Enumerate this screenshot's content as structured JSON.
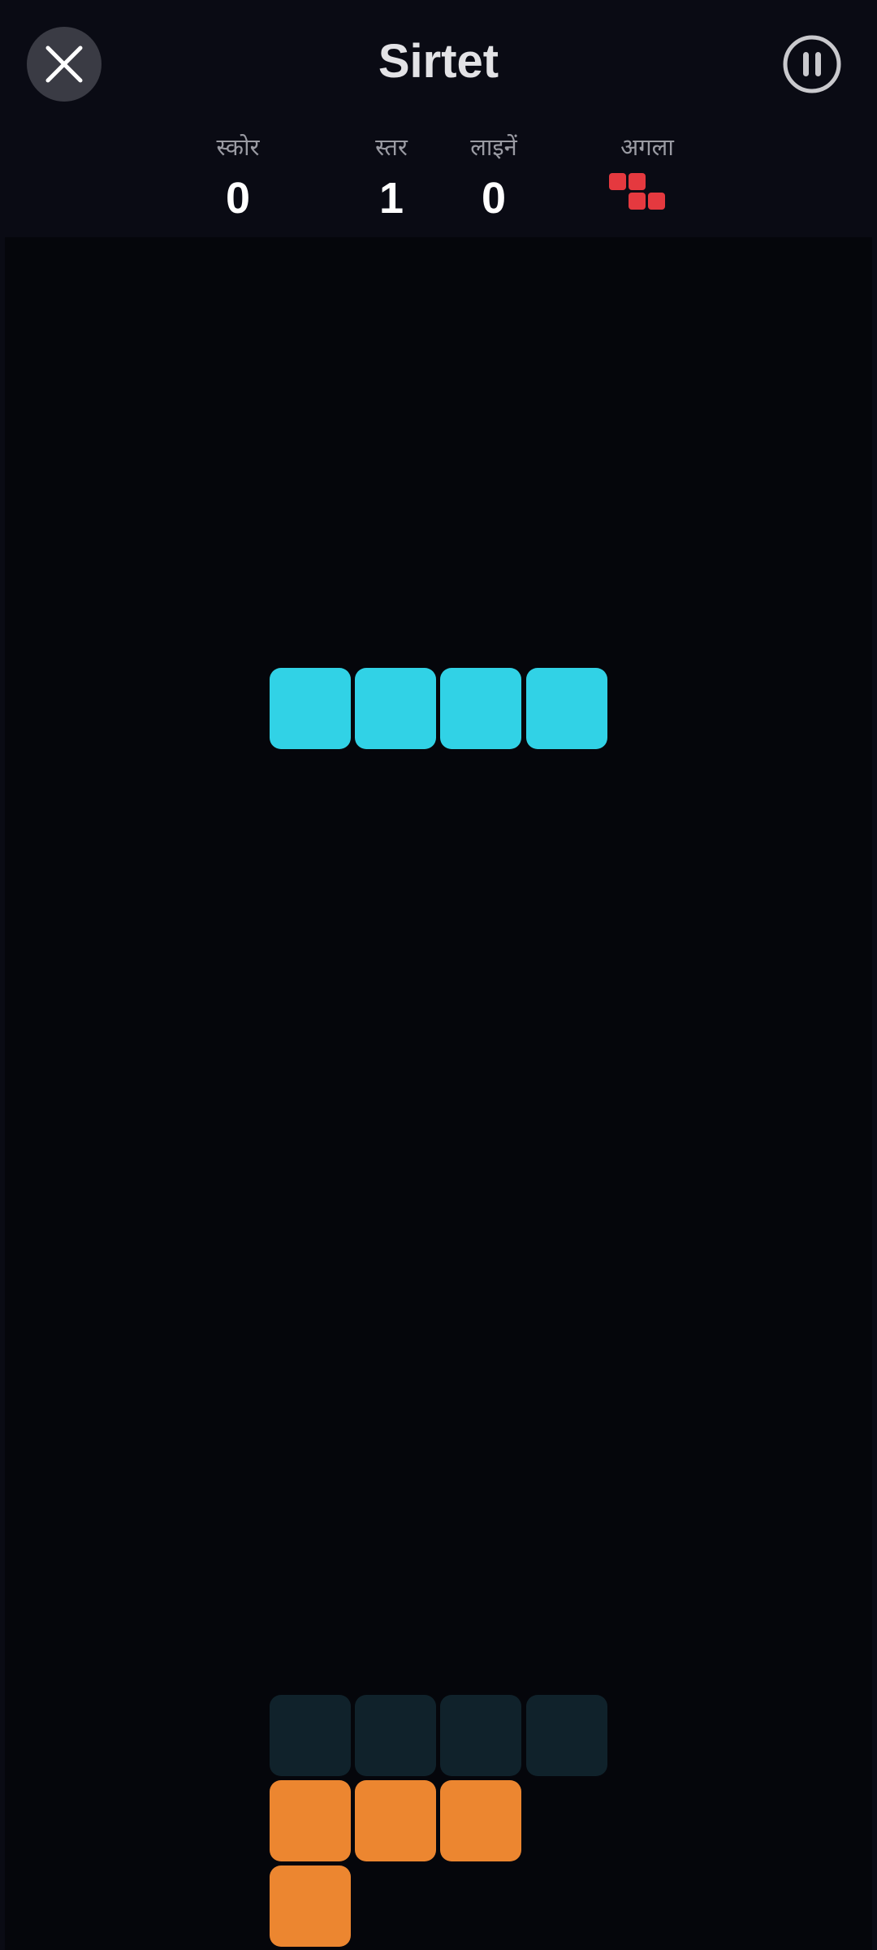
{
  "game": {
    "title": "Sirtet"
  },
  "stats": {
    "score_label": "स्कोर",
    "score_value": "0",
    "level_label": "स्तर",
    "level_value": "1",
    "lines_label": "लाइनें",
    "lines_value": "0",
    "next_label": "अगला",
    "next_piece": "Z",
    "next_color": "#e5393f"
  },
  "icons": {
    "close": "close-icon",
    "pause": "pause-icon"
  },
  "colors": {
    "background": "#0a0b14",
    "board": "#05060b",
    "active_piece": "#31d2e6",
    "ghost_piece": "#10222b",
    "locked_L": "#ec8630",
    "next_piece": "#e5393f"
  },
  "board": {
    "active_piece": "I",
    "locked_pieces": [
      "L"
    ]
  }
}
